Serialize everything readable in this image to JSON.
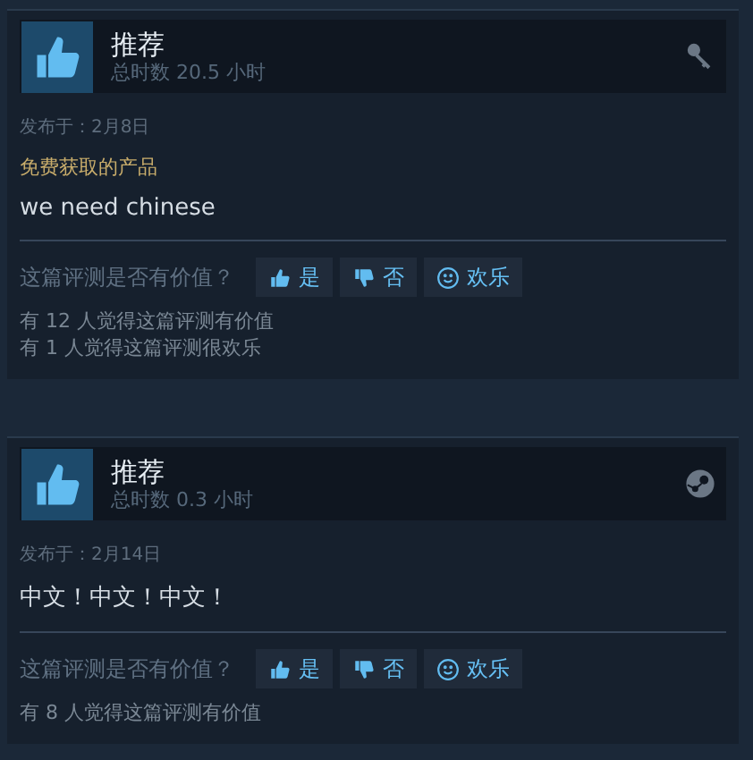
{
  "reviews": [
    {
      "title": "推荐",
      "hours": "总时数 20.5 小时",
      "kind": "key",
      "posted": "发布于：2月8日",
      "source": "免费获取的产品",
      "text": "we need chinese",
      "question": "这篇评测是否有价值？",
      "buttons": [
        {
          "kind": "yes",
          "label": "是"
        },
        {
          "kind": "no",
          "label": "否"
        },
        {
          "kind": "funny",
          "label": "欢乐"
        }
      ],
      "stats": [
        "有 12 人觉得这篇评测有价值",
        "有 1 人觉得这篇评测很欢乐"
      ]
    },
    {
      "title": "推荐",
      "hours": "总时数 0.3 小时",
      "kind": "steam",
      "posted": "发布于：2月14日",
      "text": "中文！中文！中文！",
      "question": "这篇评测是否有价值？",
      "buttons": [
        {
          "kind": "yes",
          "label": "是"
        },
        {
          "kind": "no",
          "label": "否"
        },
        {
          "kind": "funny",
          "label": "欢乐"
        }
      ],
      "stats": [
        "有 8 人觉得这篇评测有价值"
      ]
    }
  ]
}
